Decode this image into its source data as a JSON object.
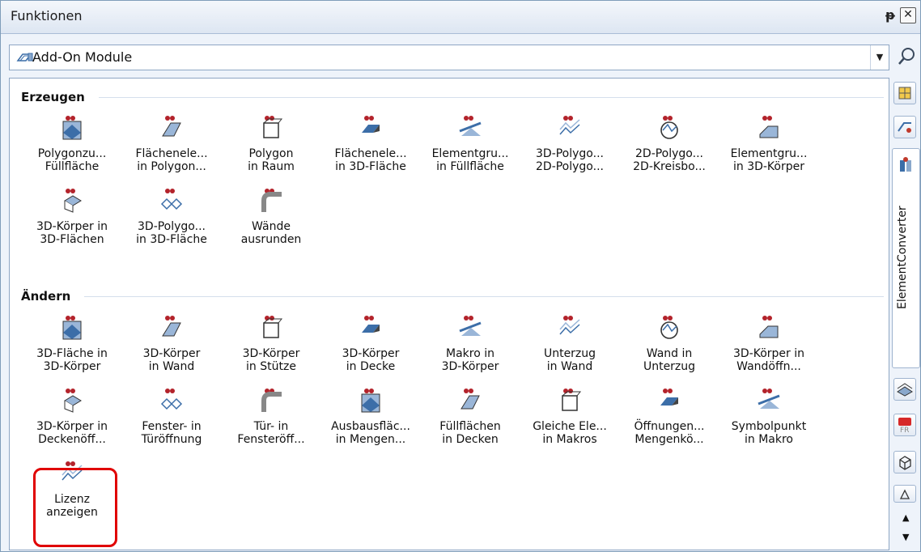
{
  "window": {
    "title": "Funktionen",
    "pin": "ᵽ",
    "close": "✕"
  },
  "combo": {
    "value": "Add-On Module",
    "icon": "module-icon"
  },
  "sections": {
    "erzeugen": "Erzeugen",
    "aendern": "Ändern"
  },
  "erzeugen_items": [
    {
      "l1": "Polygonzu...",
      "l2": "Füllfläche"
    },
    {
      "l1": "Flächenele...",
      "l2": "in Polygon..."
    },
    {
      "l1": "Polygon",
      "l2": "in Raum"
    },
    {
      "l1": "Flächenele...",
      "l2": "in 3D-Fläche"
    },
    {
      "l1": "Elementgru...",
      "l2": "in Füllfläche"
    },
    {
      "l1": "3D-Polygo...",
      "l2": "2D-Polygo..."
    },
    {
      "l1": "2D-Polygo...",
      "l2": "2D-Kreisbo..."
    },
    {
      "l1": "Elementgru...",
      "l2": "in 3D-Körper"
    },
    {
      "l1": "3D-Körper in",
      "l2": "3D-Flächen"
    },
    {
      "l1": "3D-Polygo...",
      "l2": "in 3D-Fläche"
    },
    {
      "l1": "Wände",
      "l2": "ausrunden"
    }
  ],
  "aendern_items": [
    {
      "l1": "3D-Fläche in",
      "l2": "3D-Körper"
    },
    {
      "l1": "3D-Körper",
      "l2": "in Wand"
    },
    {
      "l1": "3D-Körper",
      "l2": "in Stütze"
    },
    {
      "l1": "3D-Körper",
      "l2": "in Decke"
    },
    {
      "l1": "Makro in",
      "l2": "3D-Körper"
    },
    {
      "l1": "Unterzug",
      "l2": "in Wand"
    },
    {
      "l1": "Wand in",
      "l2": "Unterzug"
    },
    {
      "l1": "3D-Körper in",
      "l2": "Wandöffn..."
    },
    {
      "l1": "3D-Körper in",
      "l2": "Deckenöff..."
    },
    {
      "l1": "Fenster- in",
      "l2": "Türöffnung"
    },
    {
      "l1": "Tür- in",
      "l2": "Fensteröff..."
    },
    {
      "l1": "Ausbausfläc...",
      "l2": "in Mengen..."
    },
    {
      "l1": "Füllflächen",
      "l2": "in Decken"
    },
    {
      "l1": "Gleiche Ele...",
      "l2": "in Makros"
    },
    {
      "l1": "Öffnungen...",
      "l2": "Mengenkö..."
    },
    {
      "l1": "Symbolpunkt",
      "l2": "in Makro"
    },
    {
      "l1": "Lizenz",
      "l2": "anzeigen"
    }
  ],
  "sidebar": {
    "tab_label": "ElementConverter",
    "up": "▲",
    "down": "▼"
  },
  "colors": {
    "accent_red": "#e00000",
    "icon_blue": "#3c6ea8"
  }
}
